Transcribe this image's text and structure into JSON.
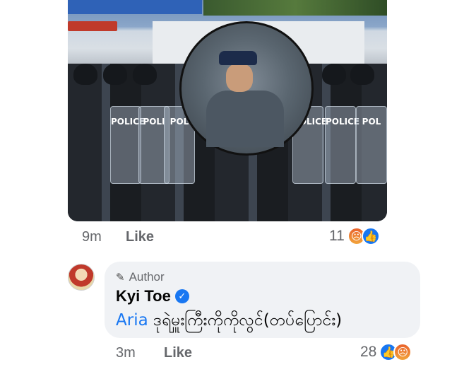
{
  "photo": {
    "shield_texts": [
      "POLICE",
      "POLI",
      "POL",
      "POLICE",
      "POLICE",
      "POL"
    ]
  },
  "post_meta": {
    "time": "9m",
    "like_label": "Like",
    "reaction_count": "11"
  },
  "comment": {
    "author_badge": "Author",
    "name": "Kyi Toe",
    "mention": "Aria",
    "text": "ဒုရဲမှူးကြီးကိုကိုလွင်(တပ်ပြောင်း)",
    "time": "3m",
    "like_label": "Like",
    "reaction_count": "28"
  },
  "colors": {
    "link": "#1877f2",
    "bubble": "#f0f2f5",
    "meta": "#65676b"
  },
  "icons": {
    "angry": "angry-reaction-icon",
    "like": "like-reaction-icon",
    "verified": "verified-badge-icon",
    "author": "pen-icon"
  }
}
